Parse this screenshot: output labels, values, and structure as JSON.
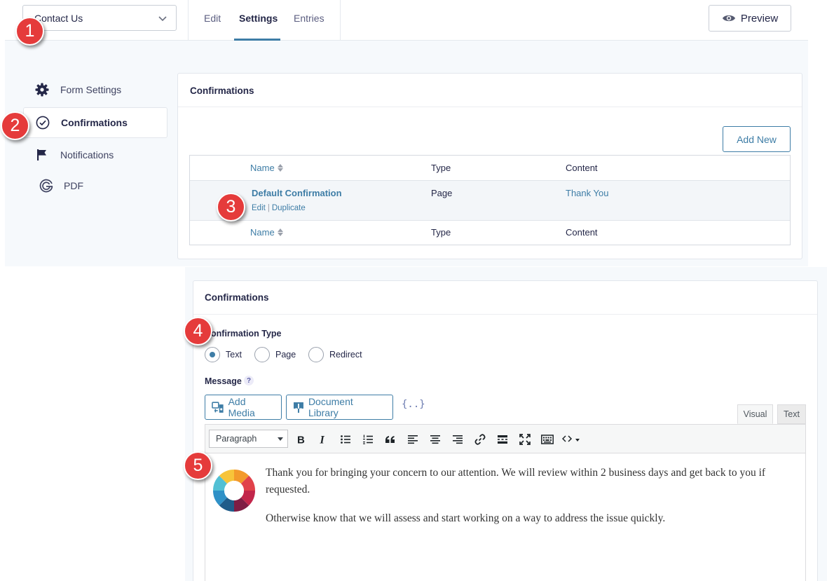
{
  "topbar": {
    "form_selector": "Contact Us",
    "tabs": [
      "Edit",
      "Settings",
      "Entries"
    ],
    "active_tab": "Settings",
    "preview_label": "Preview"
  },
  "sidebar": {
    "items": [
      {
        "label": "Form Settings",
        "icon": "gear-icon"
      },
      {
        "label": "Confirmations",
        "icon": "check-circle-icon",
        "active": true
      },
      {
        "label": "Notifications",
        "icon": "flag-icon"
      },
      {
        "label": "PDF",
        "icon": "gravity-pdf-icon"
      }
    ]
  },
  "confirmations_list": {
    "title": "Confirmations",
    "add_new_label": "Add New",
    "columns": [
      "Name",
      "Type",
      "Content"
    ],
    "rows": [
      {
        "name": "Default Confirmation",
        "type": "Page",
        "content": "Thank You",
        "actions": [
          "Edit",
          "Duplicate"
        ]
      }
    ]
  },
  "confirmation_editor": {
    "title": "Confirmations",
    "type_label": "Confirmation Type",
    "type_options": [
      "Text",
      "Page",
      "Redirect"
    ],
    "selected_type": "Text",
    "message_label": "Message",
    "help_symbol": "?",
    "add_media_label": "Add Media",
    "document_library_label": "Document Library",
    "merge_tag_symbol": "{..}",
    "editor_tabs": [
      "Visual",
      "Text"
    ],
    "format_select": "Paragraph",
    "content": {
      "paragraph1": "Thank you for bringing your concern to our attention.  We will review within 2 business days and get back to you if requested.",
      "paragraph2": "Otherwise know that we will assess and start working on a way to address the issue quickly."
    }
  },
  "callouts": [
    "1",
    "2",
    "3",
    "4",
    "5"
  ],
  "colors": {
    "accent_blue": "#3e7da6",
    "badge_red": "#e53b3b",
    "panel_bg": "#f6f9fc"
  }
}
